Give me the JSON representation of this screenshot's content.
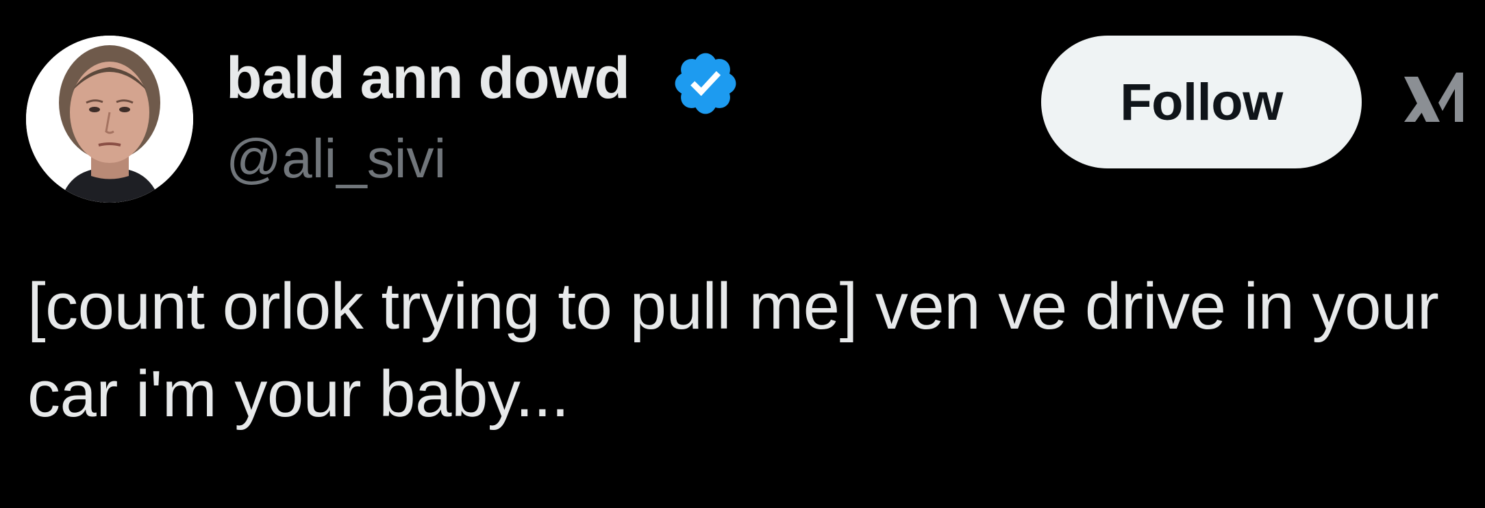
{
  "author": {
    "display_name": "bald ann dowd",
    "handle": "@ali_sivi",
    "verified": true,
    "verified_icon": "verified-badge-icon",
    "verified_color": "#1d9bf0",
    "avatar_icon": "avatar-photo"
  },
  "actions": {
    "follow_label": "Follow"
  },
  "brand": {
    "logo_icon": "x-logo-icon"
  },
  "tweet": {
    "text": "[count orlok trying to pull me] ven ve drive in your car i'm your baby..."
  },
  "colors": {
    "background": "#000000",
    "primary_text": "#e7e9ea",
    "secondary_text": "#71767b",
    "button_bg": "#eff3f4",
    "button_text": "#0f1419"
  }
}
